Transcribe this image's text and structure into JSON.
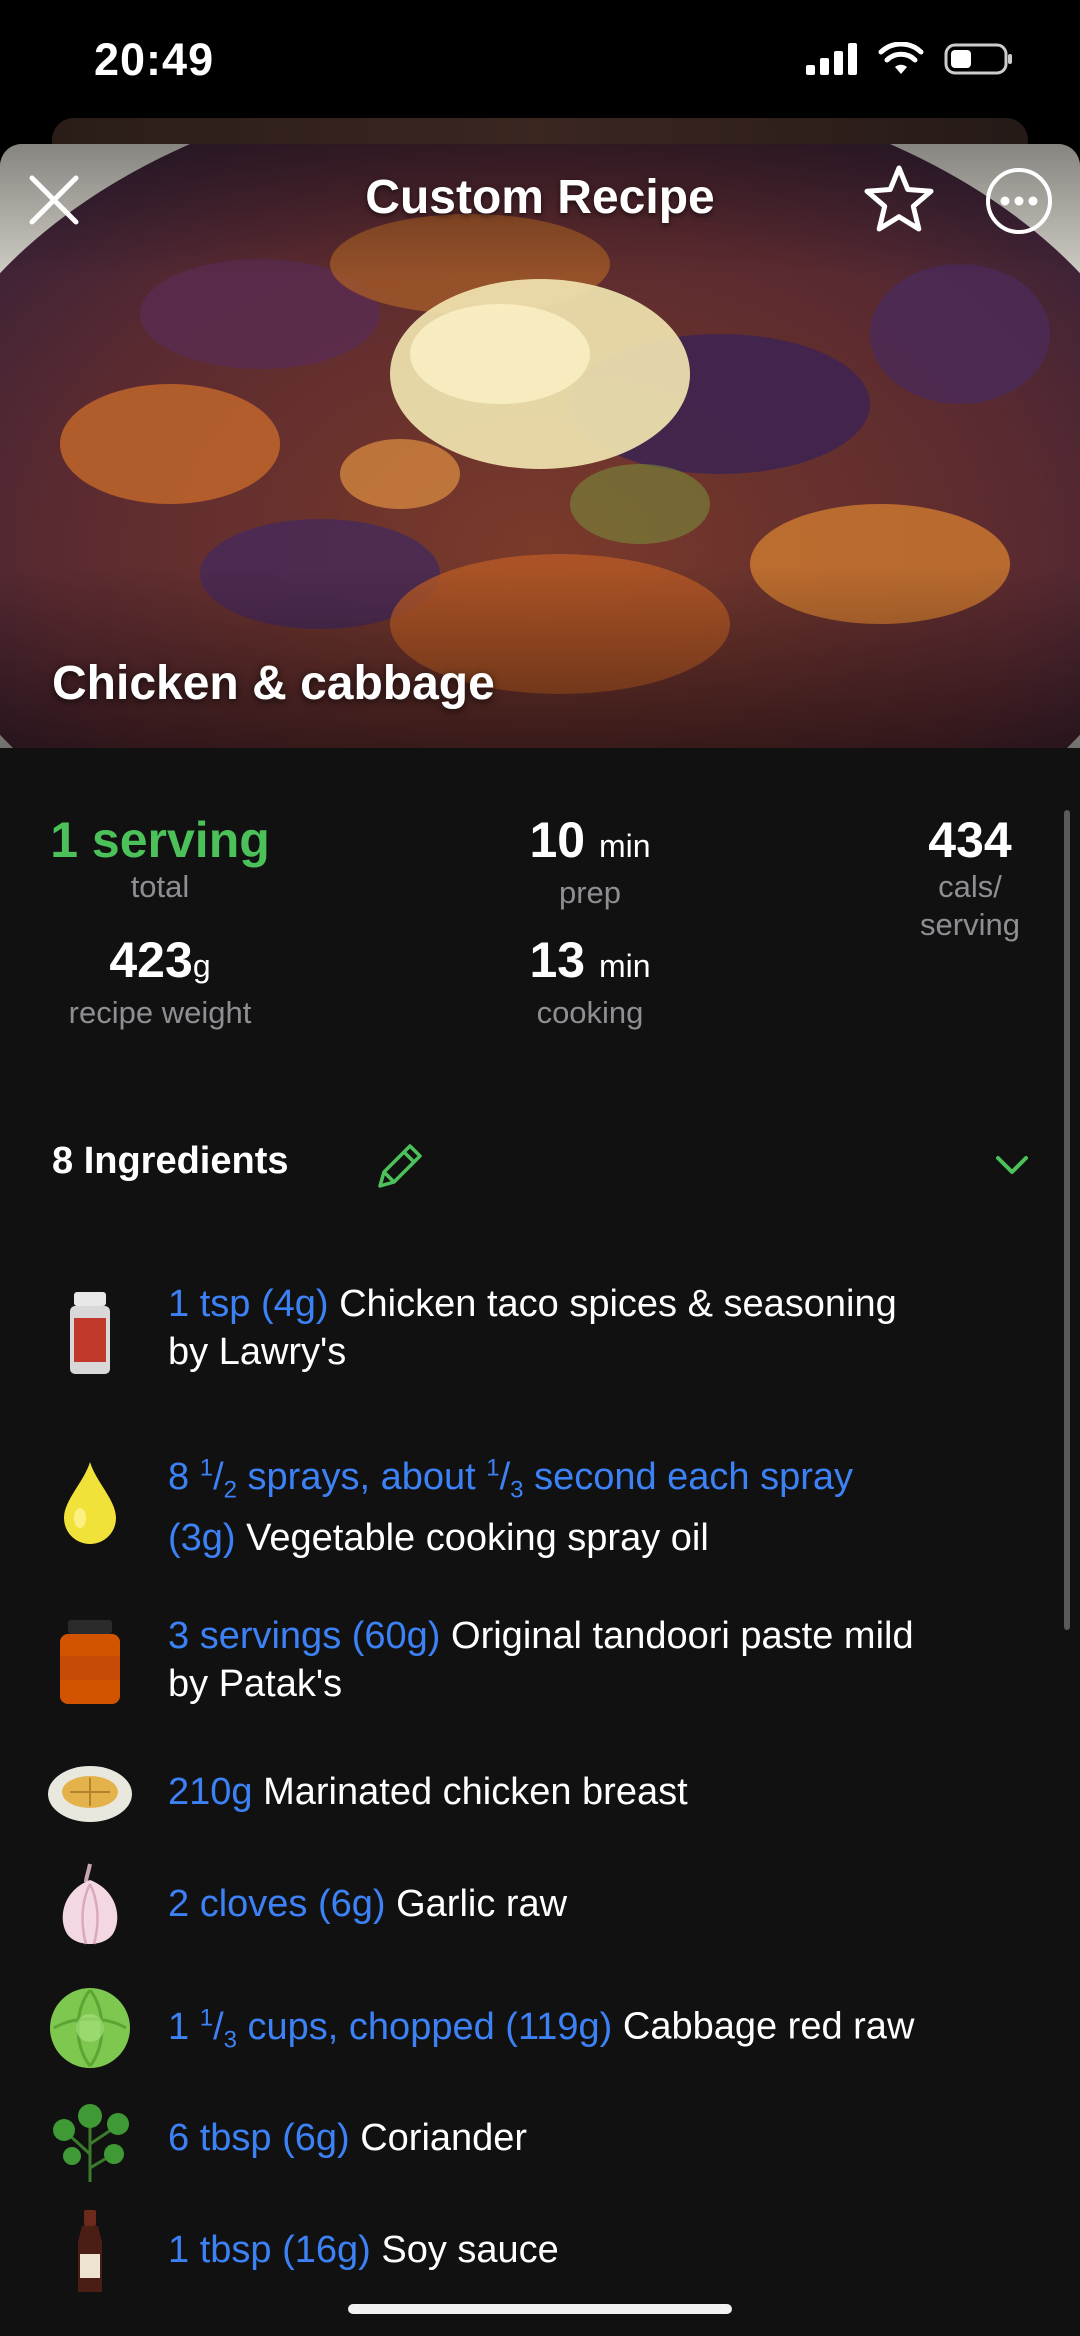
{
  "status": {
    "time": "20:49"
  },
  "header": {
    "title": "Custom Recipe"
  },
  "recipe": {
    "name": "Chicken & cabbage"
  },
  "stats": {
    "servings_value": "1 serving",
    "servings_label": "total",
    "weight_value": "423",
    "weight_unit": "g",
    "weight_label": "recipe weight",
    "prep_value": "10",
    "prep_unit": "min",
    "prep_label": "prep",
    "cooking_value": "13",
    "cooking_unit": "min",
    "cooking_label": "cooking",
    "calories_value": "434",
    "calories_label_1": "cals/",
    "calories_label_2": "serving"
  },
  "ingredients_section": {
    "title": "8 Ingredients"
  },
  "ingredients": [
    {
      "qty": "1 tsp (4g)",
      "name": "Chicken taco spices & seasoning",
      "brand_line": "by Lawry's",
      "icon": "spice-jar-icon"
    },
    {
      "qty_pre": "8 ",
      "qty_f1_num": "1",
      "qty_f1_den": "2",
      "qty_mid": " sprays, about ",
      "qty_f2_num": "1",
      "qty_f2_den": "3",
      "qty_post": " second each spray",
      "qty_line2": "(3g)",
      "name": "Vegetable cooking spray oil",
      "icon": "oil-drop-icon"
    },
    {
      "qty": "3 servings (60g)",
      "name": "Original tandoori paste mild",
      "brand_line": "by Patak's",
      "icon": "paste-jar-icon"
    },
    {
      "qty": "210g",
      "name": "Marinated chicken breast",
      "icon": "chicken-plate-icon"
    },
    {
      "qty": "2 cloves (6g)",
      "name": "Garlic raw",
      "icon": "garlic-icon"
    },
    {
      "qty_pre": "1 ",
      "qty_f1_num": "1",
      "qty_f1_den": "3",
      "qty_post": " cups, chopped (119g)",
      "name": "Cabbage red raw",
      "icon": "cabbage-icon"
    },
    {
      "qty": "6 tbsp (6g)",
      "name": "Coriander",
      "icon": "herb-icon"
    },
    {
      "qty": "1 tbsp (16g)",
      "name": "Soy sauce",
      "icon": "sauce-bottle-icon"
    }
  ],
  "colors": {
    "accent_green": "#4cc15a",
    "quantity_blue": "#3c82f6",
    "background": "#111111"
  }
}
